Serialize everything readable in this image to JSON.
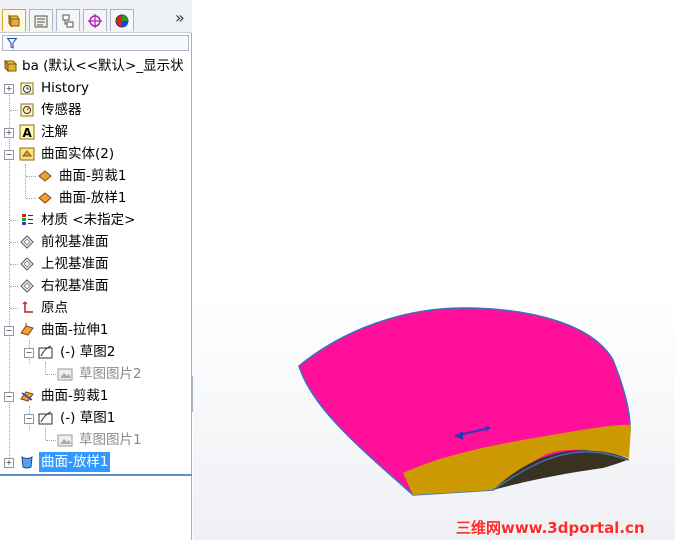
{
  "feature_manager": {
    "tabs": [
      {
        "name": "featuremanager-tab-icon"
      },
      {
        "name": "propertymanager-tab-icon"
      },
      {
        "name": "configurationmanager-tab-icon"
      },
      {
        "name": "dimxpert-tab-icon"
      },
      {
        "name": "displaymanager-tab-icon"
      }
    ],
    "more_label": "»",
    "root_label": "ba  (默认<<默认>_显示状",
    "items": [
      {
        "label": "History"
      },
      {
        "label": "传感器"
      },
      {
        "label": "注解"
      },
      {
        "label": "曲面实体(2)"
      },
      {
        "label": "曲面-剪裁1"
      },
      {
        "label": "曲面-放样1"
      },
      {
        "label": "材质 <未指定>"
      },
      {
        "label": "前视基准面"
      },
      {
        "label": "上视基准面"
      },
      {
        "label": "右视基准面"
      },
      {
        "label": "原点"
      },
      {
        "label": "曲面-拉伸1"
      },
      {
        "label": "(-) 草图2"
      },
      {
        "label": "草图图片2"
      },
      {
        "label": "曲面-剪裁1"
      },
      {
        "label": "(-) 草图1"
      },
      {
        "label": "草图图片1"
      },
      {
        "label": "曲面-放样1"
      }
    ]
  },
  "viewport": {
    "surface_colors": {
      "main": "#ff0f9a",
      "trim": "#cc9a00",
      "inner": "#3a3220",
      "edge": "#3b6fbf"
    },
    "watermark": "三维网www.3dportal.cn"
  }
}
